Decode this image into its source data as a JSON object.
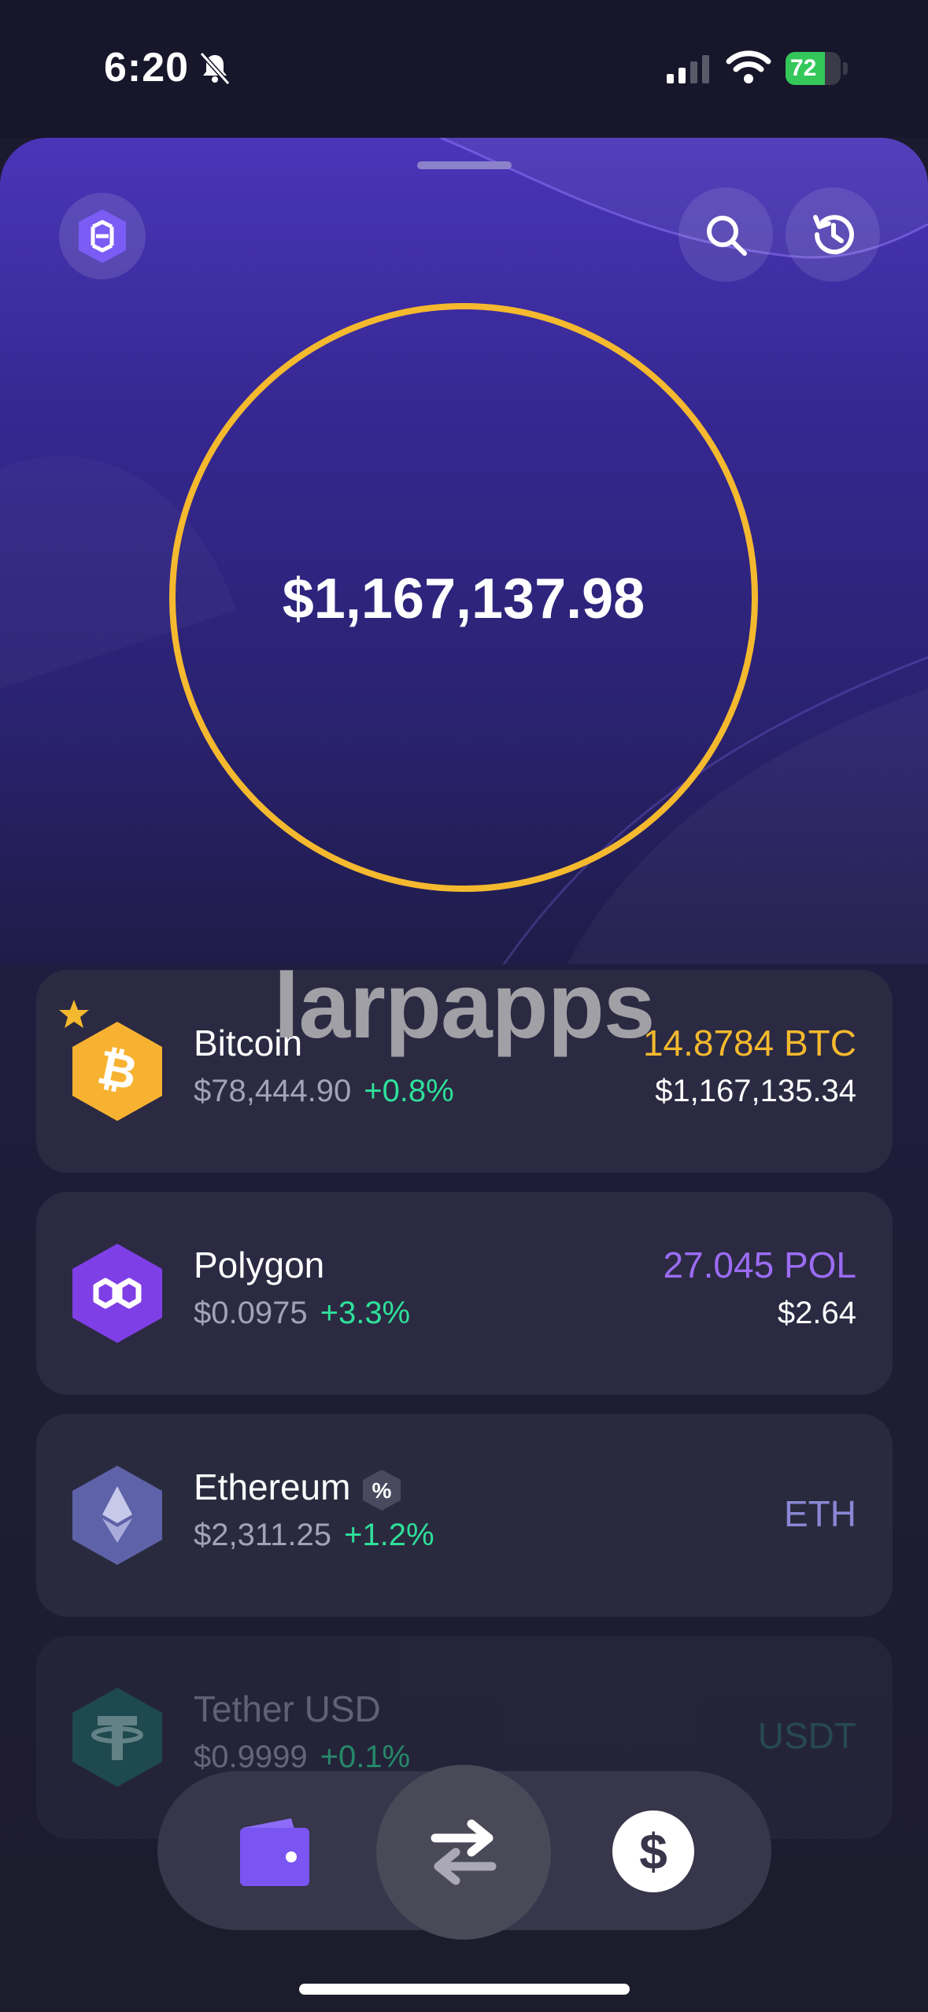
{
  "status_bar": {
    "time": "6:20",
    "battery": "72",
    "battery_level": 0.72
  },
  "hero": {
    "balance": "$1,167,137.98",
    "ring_color": "#f4b92e"
  },
  "watermark": "larpapps",
  "assets": [
    {
      "name": "Bitcoin",
      "price": "$78,444.90",
      "change": "+0.8%",
      "amount": "14.8784 BTC",
      "value": "$1,167,135.34",
      "amount_color": "#f4b92e",
      "icon": "bitcoin-icon",
      "favorite": true
    },
    {
      "name": "Polygon",
      "price": "$0.0975",
      "change": "+3.3%",
      "amount": "27.045 POL",
      "value": "$2.64",
      "amount_color": "#9b6cf5",
      "icon": "polygon-icon"
    },
    {
      "name": "Ethereum",
      "price": "$2,311.25",
      "change": "+1.2%",
      "ticker": "ETH",
      "ticker_color": "#8a87d6",
      "icon": "ethereum-icon",
      "badge": "%"
    },
    {
      "name": "Tether USD",
      "price": "$0.9999",
      "change": "+0.1%",
      "ticker": "USDT",
      "ticker_color": "#2e6f6a",
      "icon": "tether-icon"
    }
  ],
  "bottom_nav": {
    "dollar_label": "$"
  },
  "colors": {
    "accent_purple": "#6c4cf0",
    "positive": "#2fe09a",
    "gold": "#f4b92e"
  }
}
